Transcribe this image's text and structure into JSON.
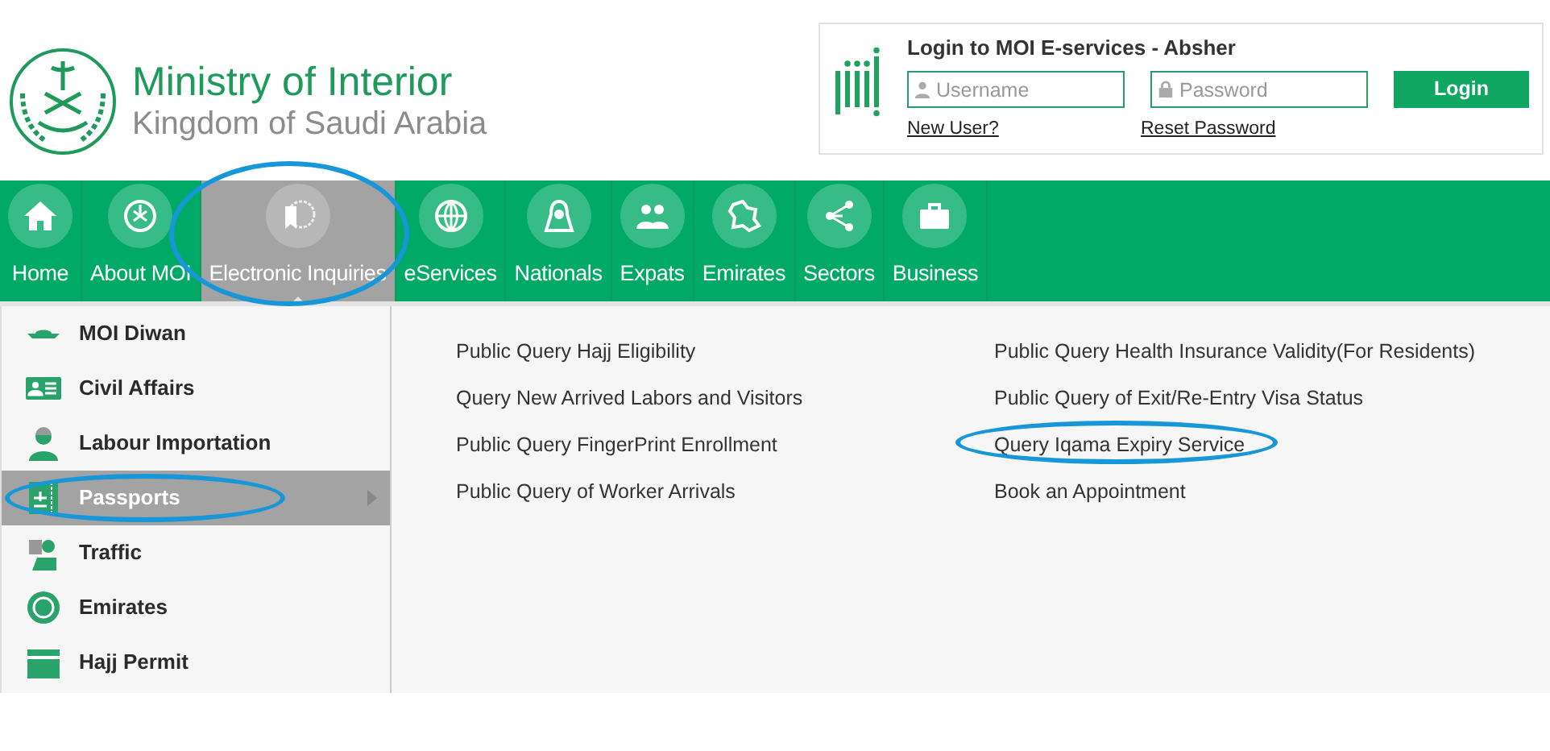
{
  "header": {
    "title": "Ministry of Interior",
    "subtitle": "Kingdom of Saudi Arabia"
  },
  "login": {
    "title": "Login to MOI E-services - Absher",
    "username": {
      "placeholder": "Username"
    },
    "password": {
      "placeholder": "Password"
    },
    "button": "Login",
    "new_user": "New User?",
    "reset_password": "Reset Password"
  },
  "nav": [
    {
      "label": "Home",
      "selected": false,
      "circled": false
    },
    {
      "label": "About MOI",
      "selected": false,
      "circled": false
    },
    {
      "label": "Electronic Inquiries",
      "selected": true,
      "circled": true
    },
    {
      "label": "eServices",
      "selected": false,
      "circled": false
    },
    {
      "label": "Nationals",
      "selected": false,
      "circled": false
    },
    {
      "label": "Expats",
      "selected": false,
      "circled": false
    },
    {
      "label": "Emirates",
      "selected": false,
      "circled": false
    },
    {
      "label": "Sectors",
      "selected": false,
      "circled": false
    },
    {
      "label": "Business",
      "selected": false,
      "circled": false
    }
  ],
  "sidebar": [
    {
      "label": "MOI Diwan",
      "selected": false,
      "circled": false
    },
    {
      "label": "Civil Affairs",
      "selected": false,
      "circled": false
    },
    {
      "label": "Labour Importation",
      "selected": false,
      "circled": false
    },
    {
      "label": "Passports",
      "selected": true,
      "circled": true
    },
    {
      "label": "Traffic",
      "selected": false,
      "circled": false
    },
    {
      "label": "Emirates",
      "selected": false,
      "circled": false
    },
    {
      "label": "Hajj Permit",
      "selected": false,
      "circled": false
    }
  ],
  "link_columns": [
    {
      "links": [
        {
          "label": "Public Query Hajj Eligibility",
          "circled": false
        },
        {
          "label": "Query New Arrived Labors and Visitors",
          "circled": false
        },
        {
          "label": "Public Query FingerPrint Enrollment",
          "circled": false
        },
        {
          "label": "Public Query of Worker Arrivals",
          "circled": false
        }
      ]
    },
    {
      "links": [
        {
          "label": "Public Query Health Insurance Validity(For Residents)",
          "circled": false
        },
        {
          "label": "Public Query of Exit/Re-Entry Visa Status",
          "circled": false
        },
        {
          "label": "Query Iqama Expiry Service",
          "circled": true
        },
        {
          "label": "Book an Appointment",
          "circled": false
        }
      ]
    }
  ]
}
